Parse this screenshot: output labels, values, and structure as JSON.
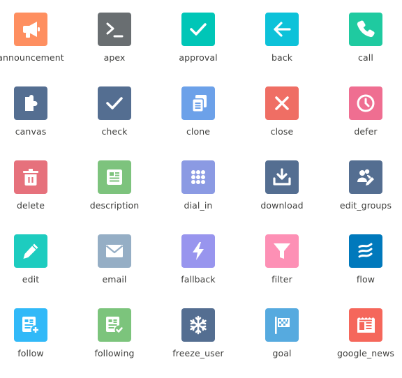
{
  "icons": [
    {
      "name": "announcement",
      "icon": "megaphone-icon",
      "color": "#fe8f60"
    },
    {
      "name": "apex",
      "icon": "terminal-prompt-icon",
      "color": "#696e71"
    },
    {
      "name": "approval",
      "icon": "checkmark-icon",
      "color": "#00c6b7"
    },
    {
      "name": "back",
      "icon": "arrow-left-icon",
      "color": "#0dc2d9"
    },
    {
      "name": "call",
      "icon": "phone-icon",
      "color": "#1fcaa0"
    },
    {
      "name": "canvas",
      "icon": "puzzle-piece-icon",
      "color": "#546e91"
    },
    {
      "name": "check",
      "icon": "checkmark-icon",
      "color": "#546e91"
    },
    {
      "name": "clone",
      "icon": "copy-documents-icon",
      "color": "#6ca1e9"
    },
    {
      "name": "close",
      "icon": "x-icon",
      "color": "#ef6e64"
    },
    {
      "name": "defer",
      "icon": "clock-icon",
      "color": "#ef6e91"
    },
    {
      "name": "delete",
      "icon": "trash-icon",
      "color": "#e6717c"
    },
    {
      "name": "description",
      "icon": "document-text-icon",
      "color": "#7dc37d"
    },
    {
      "name": "dial_in",
      "icon": "dial-pad-icon",
      "color": "#8b9ae3"
    },
    {
      "name": "download",
      "icon": "download-tray-icon",
      "color": "#546e91"
    },
    {
      "name": "edit_groups",
      "icon": "users-pencil-icon",
      "color": "#546e91"
    },
    {
      "name": "edit",
      "icon": "pencil-icon",
      "color": "#1dccbf"
    },
    {
      "name": "email",
      "icon": "envelope-icon",
      "color": "#95aec5"
    },
    {
      "name": "fallback",
      "icon": "lightning-bolt-icon",
      "color": "#9895ee"
    },
    {
      "name": "filter",
      "icon": "funnel-icon",
      "color": "#fd90b5"
    },
    {
      "name": "flow",
      "icon": "waves-icon",
      "color": "#0079bc"
    },
    {
      "name": "follow",
      "icon": "feed-plus-icon",
      "color": "#31b9f8"
    },
    {
      "name": "following",
      "icon": "feed-check-icon",
      "color": "#7cc47c"
    },
    {
      "name": "freeze_user",
      "icon": "snowflake-icon",
      "color": "#546e91"
    },
    {
      "name": "goal",
      "icon": "checkered-flag-icon",
      "color": "#56aadf"
    },
    {
      "name": "google_news",
      "icon": "newspaper-icon",
      "color": "#f5675b"
    }
  ]
}
